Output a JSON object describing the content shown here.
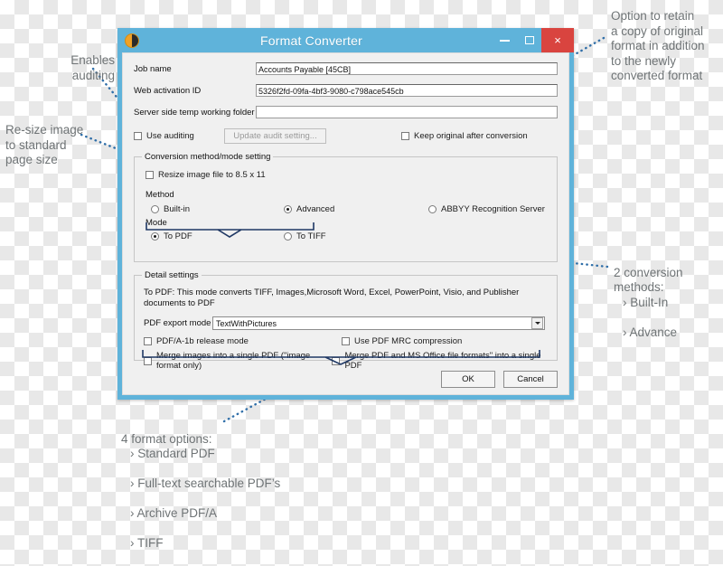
{
  "window": {
    "title": "Format Converter",
    "icon": "app-logo-icon",
    "minimize_label": "–",
    "maximize_label": "❐",
    "close_label": "×",
    "border_color": "#5fb3da",
    "close_color": "#d9443f"
  },
  "form": {
    "job_name_label": "Job name",
    "job_name_value": "Accounts Payable [45CB]",
    "web_activation_label": "Web activation ID",
    "web_activation_value": "5326f2fd-09fa-4bf3-9080-c798ace545cb",
    "temp_folder_label": "Server side temp working folder",
    "temp_folder_value": "",
    "use_auditing_label": "Use auditing",
    "use_auditing_checked": false,
    "update_audit_label": "Update audit setting...",
    "update_audit_enabled": false,
    "keep_original_label": "Keep original after conversion",
    "keep_original_checked": false
  },
  "conversion": {
    "legend": "Conversion method/mode setting",
    "resize_label": "Resize image file to 8.5 x 11",
    "resize_checked": false,
    "method_label": "Method",
    "methods": [
      {
        "label": "Built-in",
        "selected": false
      },
      {
        "label": "Advanced",
        "selected": true
      },
      {
        "label": "ABBYY Recognition Server",
        "selected": false
      }
    ],
    "mode_label": "Mode",
    "modes": [
      {
        "label": "To PDF",
        "selected": true
      },
      {
        "label": "To TIFF",
        "selected": false
      }
    ]
  },
  "detail": {
    "legend": "Detail settings",
    "description": "To PDF: This mode converts TIFF, Images,Microsoft Word, Excel, PowerPoint, Visio, and Publisher documents to PDF",
    "export_mode_label": "PDF export mode",
    "export_mode_value": "TextWithPictures",
    "checkboxes": [
      {
        "label": "PDF/A-1b release mode",
        "checked": false
      },
      {
        "label": "Use PDF MRC compression",
        "checked": false
      },
      {
        "label": "Merge images into a single PDF (\"image format only)",
        "checked": false
      },
      {
        "label": "Merge PDF and MS Office file formats\" into a single PDF",
        "checked": false
      }
    ]
  },
  "footer": {
    "ok_label": "OK",
    "cancel_label": "Cancel"
  },
  "annotations": {
    "enables_auditing": "Enables\nauditing",
    "resize_image": "Re-size image\nto standard\npage size",
    "keep_original": "Option to retain\na copy of original\nformat in addition\nto the newly\nconverted format",
    "two_methods_title": "2 conversion\nmethods:",
    "two_methods_items": [
      "› Built-In",
      "› Advance"
    ],
    "four_formats_title": "4 format options:",
    "four_formats_items": [
      "› Standard PDF",
      "› Full-text searchable PDF’s",
      "› Archive PDF/A",
      "› TIFF"
    ],
    "dot_color": "#2f6ea8"
  }
}
